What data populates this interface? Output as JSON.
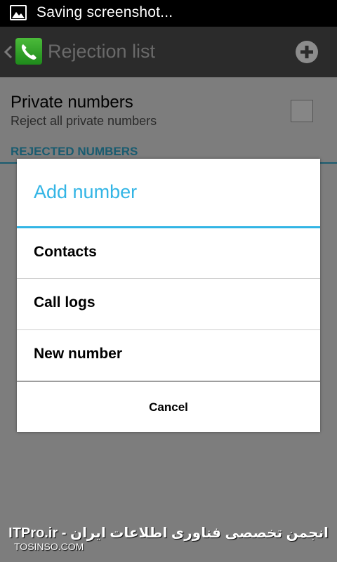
{
  "status_bar": {
    "text": "Saving screenshot...",
    "icon": "image-icon"
  },
  "action_bar": {
    "title": "Rejection list",
    "back_icon": "chevron-left-icon",
    "app_icon": "phone-icon",
    "add_icon": "plus-circle-icon"
  },
  "settings": {
    "private_numbers": {
      "title": "Private numbers",
      "summary": "Reject all private numbers",
      "checked": false
    },
    "section_header": "REJECTED NUMBERS"
  },
  "dialog": {
    "title": "Add number",
    "items": [
      {
        "label": "Contacts"
      },
      {
        "label": "Call logs"
      },
      {
        "label": "New number"
      }
    ],
    "cancel_label": "Cancel"
  },
  "watermark": {
    "main": "ITPro.ir - انجمن تخصصی فناوری اطلاعات ایران",
    "site": "TOSINSO.COM"
  },
  "colors": {
    "accent": "#33b5e5",
    "action_bar_bg": "#2b2b2b",
    "dim_overlay": "#7d7d7d"
  }
}
